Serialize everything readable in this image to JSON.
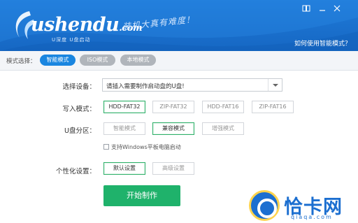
{
  "header": {
    "logo_text": "ushendu",
    "logo_domain": ".com",
    "logo_sub": "U深度 U盘启动",
    "slogan": "装机大真有难度！",
    "help_link": "如何使用智能模式？",
    "colors": {
      "bg": "#1a72d4",
      "accent": "#1a86e0"
    }
  },
  "mode_bar": {
    "label": "模式选择：",
    "tabs": [
      {
        "label": "智能模式",
        "active": true
      },
      {
        "label": "ISO模式",
        "active": false
      },
      {
        "label": "本地模式",
        "active": false
      }
    ]
  },
  "device": {
    "label": "选择设备：",
    "value": "请插入需要制作启动盘的U盘!"
  },
  "write_mode": {
    "label": "写入模式：",
    "options": [
      "HDD-FAT32",
      "ZIP-FAT32",
      "HDD-FAT16",
      "ZIP-FAT16"
    ],
    "selected": "HDD-FAT32"
  },
  "partition": {
    "label": "U盘分区：",
    "options": [
      "智能模式",
      "兼容模式",
      "增强模式"
    ],
    "selected": "兼容模式"
  },
  "tablet_boot": {
    "label": "支持Windows平板电脑启动",
    "checked": false
  },
  "personalize": {
    "label": "个性化设置：",
    "options": [
      "默认设置",
      "高级设置"
    ],
    "selected": "默认设置"
  },
  "start_button": {
    "label": "开始制作",
    "color": "#1fb26b"
  },
  "watermark": {
    "text": "恰卡网",
    "url": "qiaqa.com"
  }
}
